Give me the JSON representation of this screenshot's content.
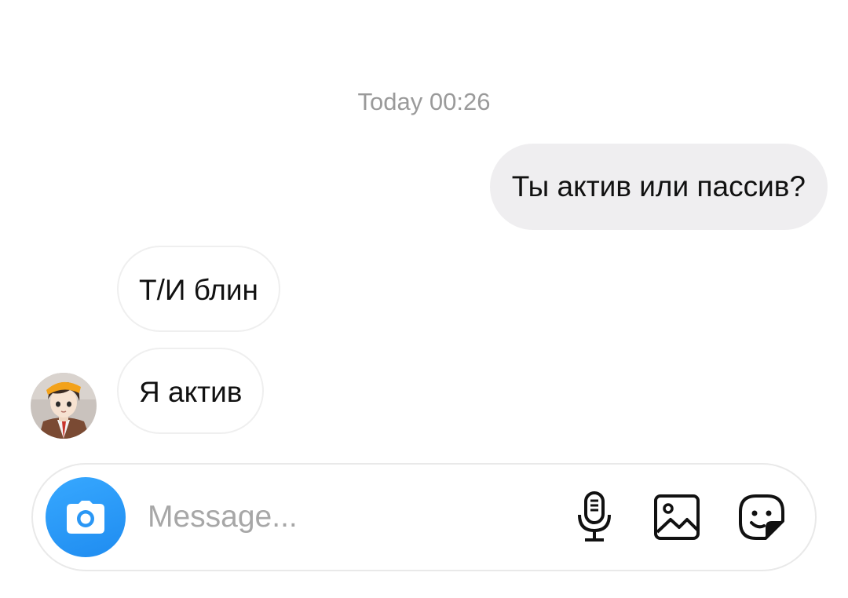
{
  "thread": {
    "timestamp": "Today 00:26",
    "messages": [
      {
        "direction": "outgoing",
        "text": "Ты актив или пассив?"
      },
      {
        "direction": "incoming",
        "text": "Т/И блин"
      },
      {
        "direction": "incoming",
        "text": "Я актив"
      }
    ],
    "avatar_icon": "anime-character-avatar"
  },
  "composer": {
    "placeholder": "Message...",
    "value": "",
    "camera_icon": "camera-icon",
    "mic_icon": "microphone-icon",
    "gallery_icon": "image-gallery-icon",
    "sticker_icon": "sticker-icon",
    "accent": "#2196F3"
  }
}
